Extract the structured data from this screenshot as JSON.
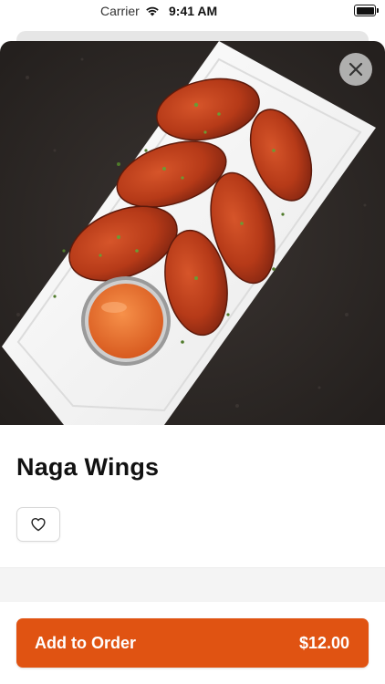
{
  "status_bar": {
    "carrier": "Carrier",
    "time": "9:41 AM"
  },
  "item": {
    "name": "Naga Wings",
    "image_icon": "chicken-wings-photo"
  },
  "actions": {
    "close_icon": "close-icon",
    "favorite_icon": "heart-outline-icon",
    "add_label": "Add to Order",
    "price": "$12.00"
  },
  "colors": {
    "accent": "#e05312",
    "close_bg": "#c8c8c8"
  }
}
